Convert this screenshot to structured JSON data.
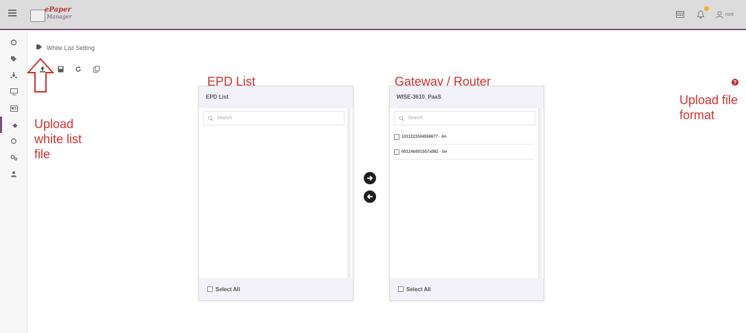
{
  "app": {
    "logo_line1": "ePaper",
    "logo_line2": "Manager",
    "user_name": "root"
  },
  "breadcrumb": {
    "label": "White List Setting"
  },
  "annotations": {
    "upload_lines": [
      "Upload",
      "white list",
      "file"
    ],
    "epd_list": "EPD List",
    "gateway": "Gateway / Router",
    "format_lines": [
      "Upload file",
      "format"
    ]
  },
  "epd_panel": {
    "title": "EPD List",
    "search_placeholder": "Search",
    "items": [],
    "select_all": "Select All"
  },
  "gateway_panel": {
    "title": "WISE-3610_PaaS",
    "search_placeholder": "Search",
    "items": [
      "1011223344556677 - bn",
      "00124b001557a082 - bn"
    ],
    "select_all": "Select All"
  },
  "colors": {
    "accent": "#7a4f78",
    "annotation_red": "#d0312d",
    "topbar": "#dcdcdc",
    "panel_header": "#f3f2f8"
  },
  "icons": {
    "sidebar": [
      "dashboard-icon",
      "tag-icon",
      "network-icon",
      "monitor-icon",
      "card-icon",
      "whitelist-icon",
      "sync-icon",
      "settings-icon",
      "user-admin-icon"
    ],
    "toolbar": [
      "upload-icon",
      "save-icon",
      "refresh-icon",
      "copy-icon"
    ],
    "move": [
      "arrow-right-icon",
      "arrow-left-icon"
    ]
  }
}
